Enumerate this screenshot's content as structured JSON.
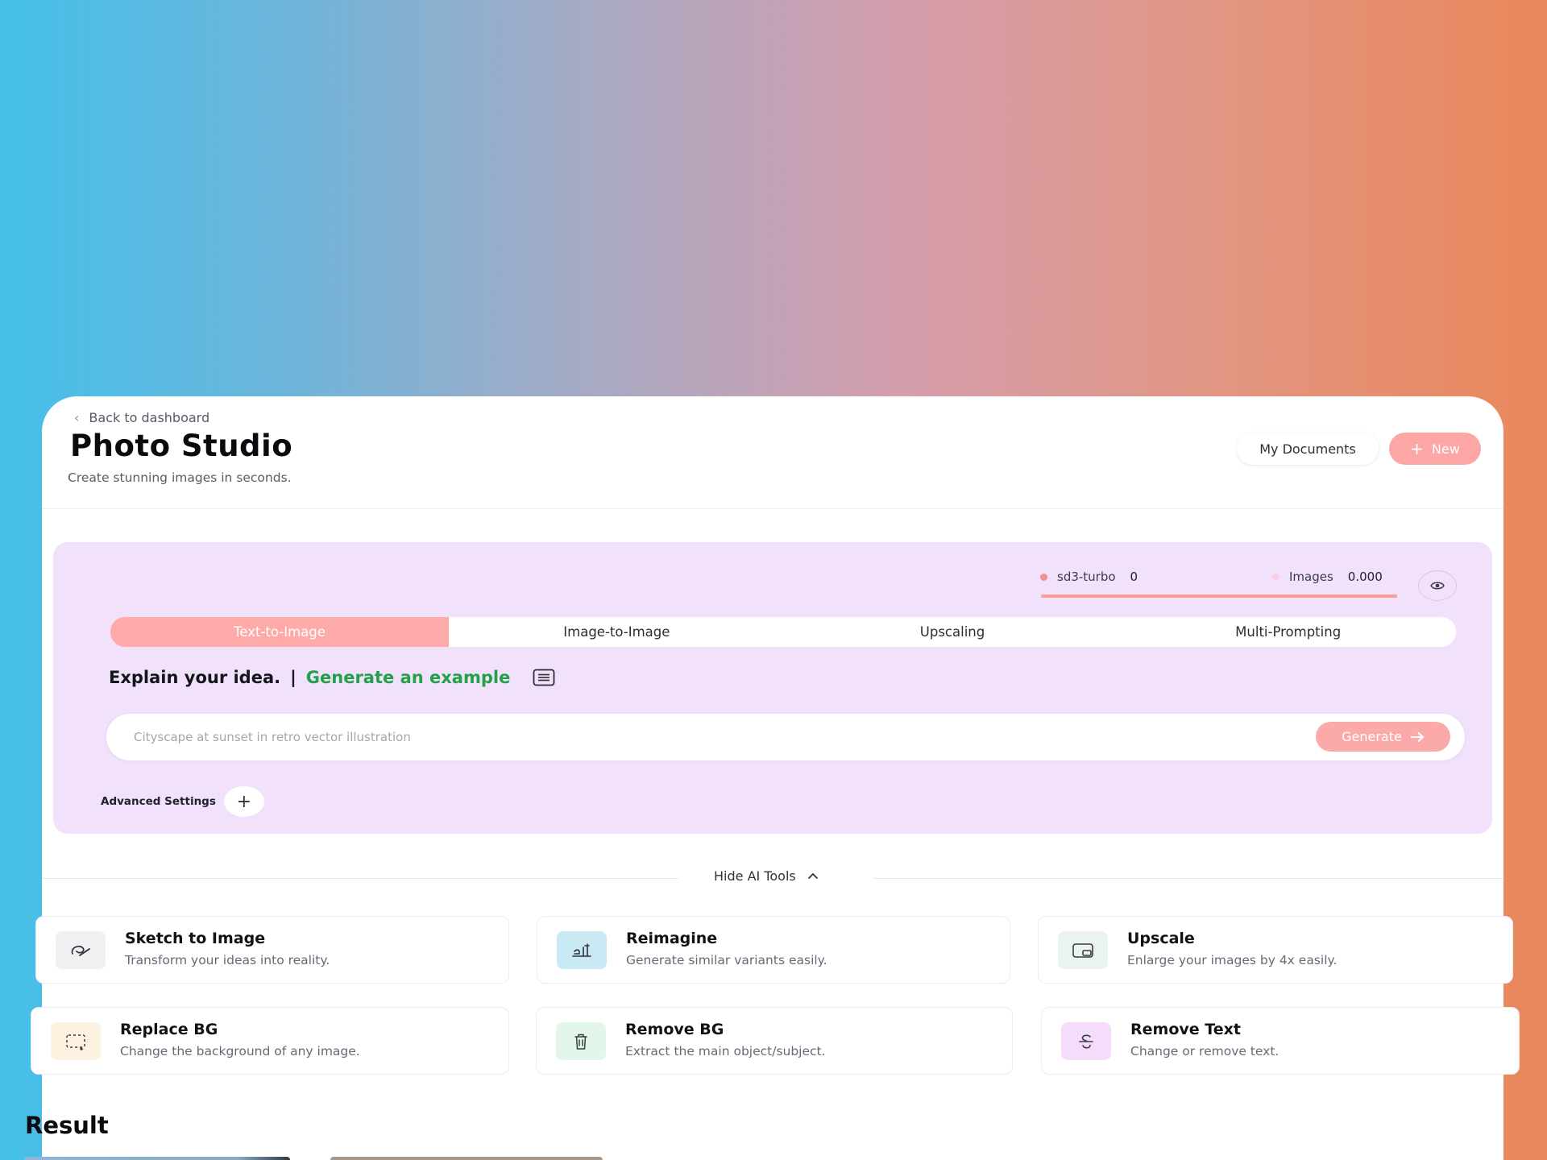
{
  "header": {
    "back_label": "Back to dashboard",
    "title": "Photo Studio",
    "subtitle": "Create stunning images in seconds.",
    "my_documents_label": "My Documents",
    "new_label": "New"
  },
  "stats": {
    "model_name": "sd3-turbo",
    "model_value": "0",
    "images_label": "Images",
    "images_value": "0.000"
  },
  "tabs": [
    {
      "label": "Text-to-Image",
      "active": true
    },
    {
      "label": "Image-to-Image",
      "active": false
    },
    {
      "label": "Upscaling",
      "active": false
    },
    {
      "label": "Multi-Prompting",
      "active": false
    }
  ],
  "prompt": {
    "heading": "Explain your idea.",
    "separator": "|",
    "example_link": "Generate an example",
    "placeholder": "Cityscape at sunset in retro vector illustration",
    "value": "",
    "generate_label": "Generate"
  },
  "advanced": {
    "label": "Advanced Settings"
  },
  "tools_toggle": {
    "label": "Hide AI Tools"
  },
  "tools": [
    {
      "name": "Sketch to Image",
      "desc": "Transform your ideas into reality.",
      "icon": "sketch-icon"
    },
    {
      "name": "Reimagine",
      "desc": "Generate similar variants easily.",
      "icon": "reimagine-icon"
    },
    {
      "name": "Upscale",
      "desc": "Enlarge your images by 4x easily.",
      "icon": "upscale-icon"
    },
    {
      "name": "Replace BG",
      "desc": "Change the background of any image.",
      "icon": "replace-bg-icon"
    },
    {
      "name": "Remove BG",
      "desc": "Extract the main object/subject.",
      "icon": "trash-icon"
    },
    {
      "name": "Remove Text",
      "desc": "Change or remove text.",
      "icon": "strikethrough-icon"
    }
  ],
  "result": {
    "title": "Result"
  },
  "colors": {
    "accent": "#fca7a6",
    "panel": "#f1e1fb",
    "link_green": "#23a049"
  }
}
